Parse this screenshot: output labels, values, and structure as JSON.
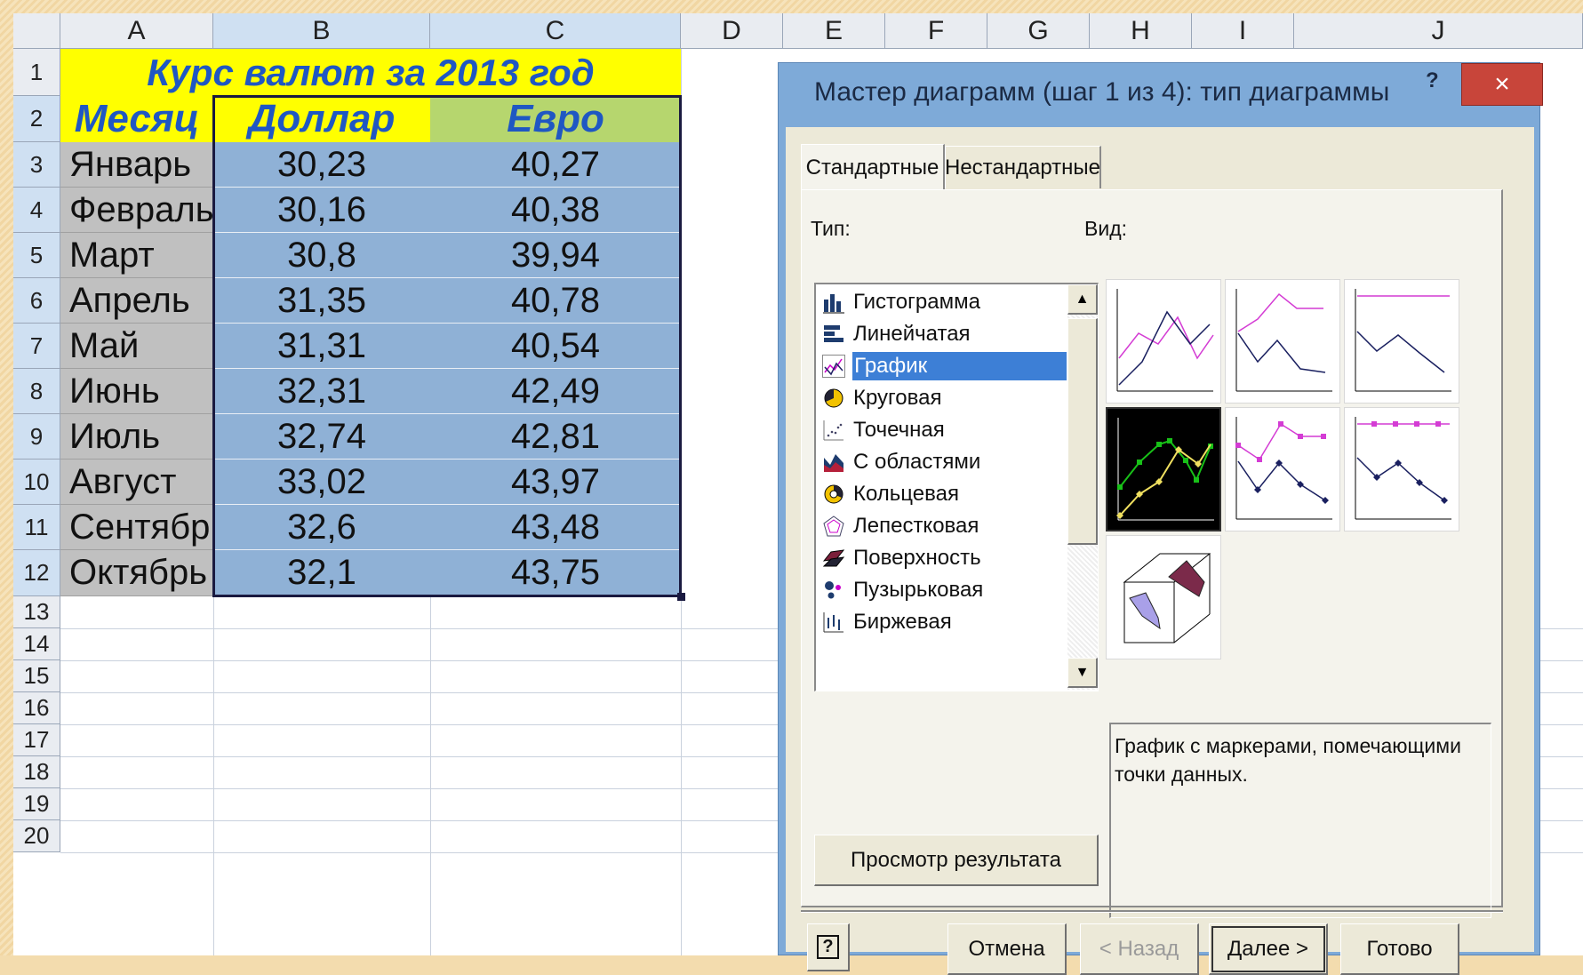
{
  "columns": [
    "A",
    "B",
    "C",
    "D",
    "E",
    "F",
    "G",
    "H",
    "I",
    "J"
  ],
  "rows": [
    "1",
    "2",
    "3",
    "4",
    "5",
    "6",
    "7",
    "8",
    "9",
    "10",
    "11",
    "12",
    "13",
    "14",
    "15",
    "16",
    "17",
    "18",
    "19",
    "20"
  ],
  "table": {
    "title": "Курс валют за 2013 год",
    "headers": [
      "Месяц",
      "Доллар",
      "Евро"
    ],
    "data": [
      {
        "month": "Январь",
        "usd": "30,23",
        "eur": "40,27"
      },
      {
        "month": "Февраль",
        "usd": "30,16",
        "eur": "40,38"
      },
      {
        "month": "Март",
        "usd": "30,8",
        "eur": "39,94"
      },
      {
        "month": "Апрель",
        "usd": "31,35",
        "eur": "40,78"
      },
      {
        "month": "Май",
        "usd": "31,31",
        "eur": "40,54"
      },
      {
        "month": "Июнь",
        "usd": "32,31",
        "eur": "42,49"
      },
      {
        "month": "Июль",
        "usd": "32,74",
        "eur": "42,81"
      },
      {
        "month": "Август",
        "usd": "33,02",
        "eur": "43,97"
      },
      {
        "month": "Сентябрь",
        "usd": "32,6",
        "eur": "43,48"
      },
      {
        "month": "Октябрь",
        "usd": "32,1",
        "eur": "43,75"
      }
    ]
  },
  "dialog": {
    "title": "Мастер диаграмм (шаг 1 из 4): тип диаграммы",
    "help_glyph": "?",
    "close_glyph": "×",
    "tabs": [
      "Стандартные",
      "Нестандартные"
    ],
    "type_label": "Тип:",
    "view_label": "Вид:",
    "chart_types": [
      {
        "label": "Гистограмма",
        "icon": "column-chart-icon"
      },
      {
        "label": "Линейчатая",
        "icon": "bar-chart-icon"
      },
      {
        "label": "График",
        "icon": "line-chart-icon",
        "selected": true
      },
      {
        "label": "Круговая",
        "icon": "pie-chart-icon"
      },
      {
        "label": "Точечная",
        "icon": "scatter-chart-icon"
      },
      {
        "label": "С областями",
        "icon": "area-chart-icon"
      },
      {
        "label": "Кольцевая",
        "icon": "doughnut-chart-icon"
      },
      {
        "label": "Лепестковая",
        "icon": "radar-chart-icon"
      },
      {
        "label": "Поверхность",
        "icon": "surface-chart-icon"
      },
      {
        "label": "Пузырьковая",
        "icon": "bubble-chart-icon"
      },
      {
        "label": "Биржевая",
        "icon": "stock-chart-icon"
      }
    ],
    "description": "График с маркерами, помечающими точки данных.",
    "preview_button": "Просмотр результата",
    "buttons": {
      "help": "?",
      "cancel": "Отмена",
      "back": "< Назад",
      "next": "Далее >",
      "finish": "Готово"
    },
    "colors": {
      "title_bar": "#7eaad8",
      "close": "#c8453a",
      "selection": "#3d7fd6"
    }
  },
  "colors": {
    "title_fill": "#ffff00",
    "header_text": "#1f57c3",
    "month_fill": "#c0c0c0",
    "value_fill": "#8fb1d6",
    "euro_header_fill": "#b6d66e"
  }
}
